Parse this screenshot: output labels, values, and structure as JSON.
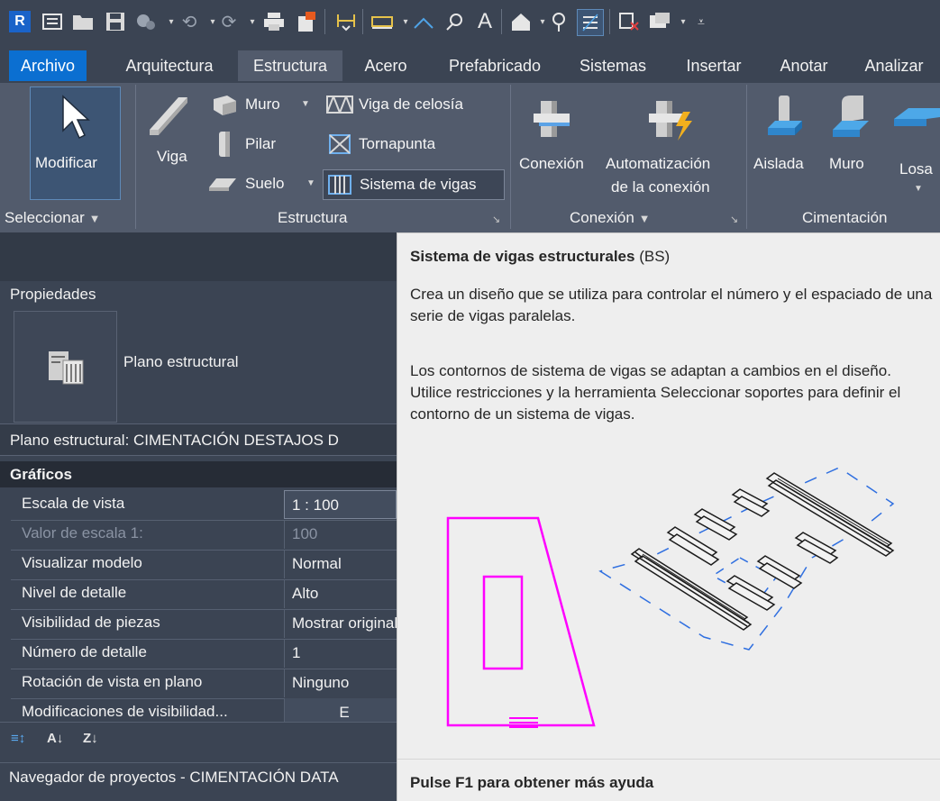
{
  "quick_access": {
    "icons": [
      "revit-logo-icon",
      "home-icon",
      "open-icon",
      "save-icon",
      "sync-icon",
      "undo-icon",
      "redo-icon",
      "print-icon",
      "export-icon",
      "align-dimension-icon",
      "measure-icon",
      "angle-icon",
      "tag-icon",
      "text-icon",
      "default-3d-view-icon",
      "section-icon",
      "thin-lines-icon",
      "close-hidden-icon",
      "switch-windows-icon",
      "customize-icon"
    ],
    "text_icon_glyph": "A"
  },
  "tabs": [
    "Archivo",
    "Arquitectura",
    "Estructura",
    "Acero",
    "Prefabricado",
    "Sistemas",
    "Insertar",
    "Anotar",
    "Analizar"
  ],
  "active_tab": "Estructura",
  "ribbon": {
    "modify_label": "Modificar",
    "select_panel": "Seleccionar",
    "beam_label": "Viga",
    "wall_label": "Muro",
    "column_label": "Pilar",
    "floor_label": "Suelo",
    "truss_label": "Viga de celosía",
    "brace_label": "Tornapunta",
    "beam_system_label": "Sistema de vigas",
    "structure_panel": "Estructura",
    "connection_label": "Conexión",
    "automation_label_1": "Automatización",
    "automation_label_2": "de la conexión",
    "connection_panel": "Conexión",
    "isolated_label": "Aislada",
    "wall_foundation_label": "Muro",
    "slab_label": "Losa",
    "foundation_panel": "Cimentación"
  },
  "properties": {
    "header": "Propiedades",
    "type_name": "Plano estructural",
    "view_line": "Plano estructural: CIMENTACIÓN DESTAJOS D",
    "group": "Gráficos",
    "rows": [
      {
        "name": "Escala de vista",
        "value": "1 : 100"
      },
      {
        "name": "Valor de escala    1:",
        "value": "100"
      },
      {
        "name": "Visualizar modelo",
        "value": "Normal"
      },
      {
        "name": "Nivel de detalle",
        "value": "Alto"
      },
      {
        "name": "Visibilidad de piezas",
        "value": "Mostrar original"
      },
      {
        "name": "Número de detalle",
        "value": "1"
      },
      {
        "name": "Rotación de vista en plano",
        "value": "Ninguno"
      },
      {
        "name": "Modificaciones de visibilidad...",
        "value": "E"
      }
    ]
  },
  "project_browser": {
    "title": "Navegador de proyectos - CIMENTACIÓN DATA"
  },
  "tooltip": {
    "title": "Sistema de vigas estructurales",
    "shortcut": "(BS)",
    "p1": "Crea un diseño que se utiliza para controlar el número y el espaciado de una serie de vigas paralelas.",
    "p2": "Los contornos de sistema de vigas se adaptan a cambios en el diseño. Utilice restricciones y la herramienta Seleccionar soportes para definir el contorno de un sistema de vigas.",
    "footer": "Pulse F1 para obtener más ayuda",
    "colors": {
      "sketch": "#ff00ff",
      "boundary": "#2f6fe0"
    }
  }
}
